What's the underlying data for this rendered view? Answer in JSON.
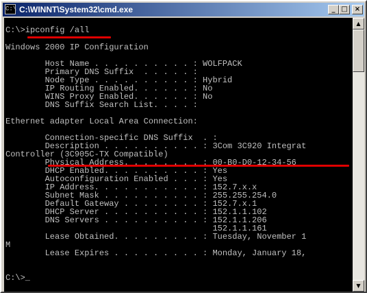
{
  "window": {
    "title": "C:\\WINNT\\System32\\cmd.exe",
    "icon_label": "C:\\",
    "controls": {
      "minimize": "_",
      "maximize": "□",
      "close": "×"
    }
  },
  "console": {
    "lines": [
      "C:\\>ipconfig /all",
      "Windows 2000 IP Configuration",
      "",
      "        Host Name . . . . . . . . . . : WOLFPACK",
      "        Primary DNS Suffix  . . . . . :",
      "        Node Type . . . . . . . . . . : Hybrid",
      "        IP Routing Enabled. . . . . . : No",
      "        WINS Proxy Enabled. . . . . . : No",
      "        DNS Suffix Search List. . . . :",
      "",
      "Ethernet adapter Local Area Connection:",
      "",
      "        Connection-specific DNS Suffix  . :",
      "        Description . . . . . . . . . . : 3Com 3C920 Integrat",
      "Controller (3C905C-TX Compatible)",
      "        Physical Address. . . . . . . . : 00-B0-D0-12-34-56",
      "        DHCP Enabled. . . . . . . . . . : Yes",
      "        Autoconfiguration Enabled . . . : Yes",
      "        IP Address. . . . . . . . . . . : 152.7.x.x",
      "        Subnet Mask . . . . . . . . . . : 255.255.254.0",
      "        Default Gateway . . . . . . . . : 152.7.x.1",
      "        DHCP Server . . . . . . . . . . : 152.1.1.102",
      "        DNS Servers . . . . . . . . . . : 152.1.1.206",
      "                                          152.1.1.161",
      "        Lease Obtained. . . . . . . . . : Tuesday, November 1",
      "M",
      "        Lease Expires . . . . . . . . . : Monday, January 18,",
      "",
      "",
      "C:\\>_"
    ],
    "highlight_color": "#e00000"
  },
  "scrollbar": {
    "up_arrow": "▲",
    "down_arrow": "▼"
  }
}
